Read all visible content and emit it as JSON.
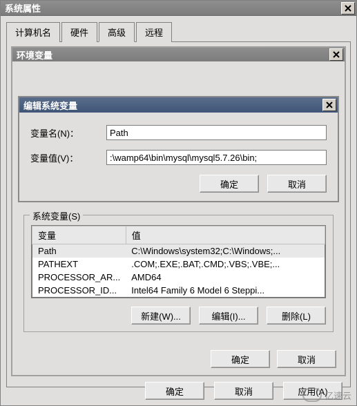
{
  "main_window": {
    "title": "系统属性"
  },
  "tabs": {
    "items": [
      {
        "label": "计算机名"
      },
      {
        "label": "硬件"
      },
      {
        "label": "高级"
      },
      {
        "label": "远程"
      }
    ],
    "active_index": 2
  },
  "env_window": {
    "title": "环境变量"
  },
  "edit_dialog": {
    "title": "编辑系统变量",
    "name_label": "变量名(N)：",
    "name_value": "Path",
    "value_label": "变量值(V)：",
    "value_value": ":\\wamp64\\bin\\mysql\\mysql5.7.26\\bin;",
    "ok_btn": "确定",
    "cancel_btn": "取消"
  },
  "sys_vars": {
    "legend": "系统变量(S)",
    "headers": {
      "var": "变量",
      "val": "值"
    },
    "rows": [
      {
        "var": "Path",
        "val": "C:\\Windows\\system32;C:\\Windows;..."
      },
      {
        "var": "PATHEXT",
        "val": ".COM;.EXE;.BAT;.CMD;.VBS;.VBE;..."
      },
      {
        "var": "PROCESSOR_AR...",
        "val": "AMD64"
      },
      {
        "var": "PROCESSOR_ID...",
        "val": "Intel64 Family 6 Model 6 Steppi..."
      }
    ],
    "new_btn": "新建(W)...",
    "edit_btn": "编辑(I)...",
    "delete_btn": "删除(L)"
  },
  "env_buttons": {
    "ok": "确定",
    "cancel": "取消"
  },
  "outer_buttons": {
    "ok": "确定",
    "cancel": "取消",
    "apply": "应用(A)"
  },
  "watermark": "亿速云"
}
